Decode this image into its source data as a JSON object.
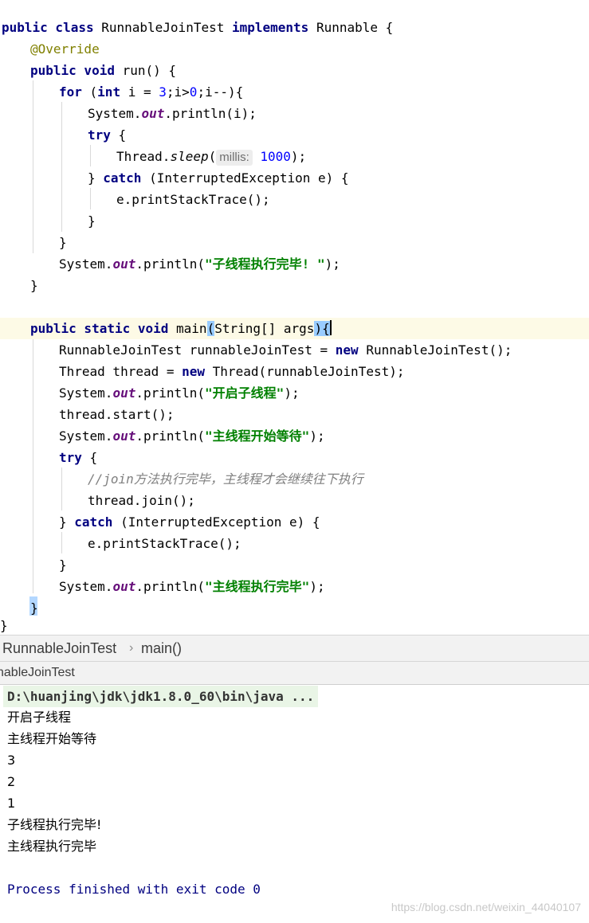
{
  "editor": {
    "code": {
      "class_decl": {
        "kw1": "public class",
        "name": " RunnableJoinTest ",
        "kw2": "implements",
        "rest": " Runnable {"
      },
      "annotation": "@Override",
      "run_decl": {
        "kw": "public void",
        "rest": " run() {"
      },
      "for_line": {
        "kw1": "for",
        "p1": " (",
        "kw2": "int",
        "p2": " i = ",
        "n1": "3",
        "p3": ";i>",
        "n2": "0",
        "p4": ";i--){"
      },
      "println_i": {
        "p1": "System.",
        "field": "out",
        "p2": ".println(i);"
      },
      "try1": {
        "kw": "try",
        "rest": " {"
      },
      "sleep": {
        "p1": "Thread.",
        "method": "sleep",
        "p2": "(",
        "hint": "millis:",
        "num": " 1000",
        "p3": ");"
      },
      "catch1": {
        "p1": "} ",
        "kw": "catch",
        "p2": " (InterruptedException e) {"
      },
      "stacktrace1": "e.printStackTrace();",
      "close_brace": "}",
      "println_done": {
        "p1": "System.",
        "field": "out",
        "p2": ".println(",
        "str": "\"子线程执行完毕! \"",
        "p3": ");"
      },
      "main_decl": {
        "kw": "public static void",
        "p1": " main",
        "open": "(",
        "p2": "String[] args",
        "close": ")",
        "brace": "{"
      },
      "new_runnable": {
        "p1": "RunnableJoinTest runnableJoinTest = ",
        "kw": "new",
        "p2": " RunnableJoinTest();"
      },
      "new_thread": {
        "p1": "Thread thread = ",
        "kw": "new",
        "p2": " Thread(runnableJoinTest);"
      },
      "println_start": {
        "p1": "System.",
        "field": "out",
        "p2": ".println(",
        "str": "\"开启子线程\"",
        "p3": ");"
      },
      "thread_start": "thread.start();",
      "println_wait": {
        "p1": "System.",
        "field": "out",
        "p2": ".println(",
        "str": "\"主线程开始等待\"",
        "p3": ");"
      },
      "try2": {
        "kw": "try",
        "rest": " {"
      },
      "comment": "//join方法执行完毕，主线程才会继续往下执行",
      "join": "thread.join();",
      "catch2": {
        "p1": "} ",
        "kw": "catch",
        "p2": " (InterruptedException e) {"
      },
      "stacktrace2": "e.printStackTrace();",
      "println_main_done": {
        "p1": "System.",
        "field": "out",
        "p2": ".println(",
        "str": "\"主线程执行完毕\"",
        "p3": ");"
      }
    }
  },
  "breadcrumb": {
    "class_name": "RunnableJoinTest",
    "separator": "›",
    "method": "main()"
  },
  "run_panel": {
    "tab_label": "nableJoinTest"
  },
  "console": {
    "command": "D:\\huanjing\\jdk\\jdk1.8.0_60\\bin\\java ...",
    "output": [
      "开启子线程",
      "主线程开始等待",
      "3",
      "2",
      "1",
      "子线程执行完毕!",
      "主线程执行完毕"
    ],
    "exit_message": "Process finished with exit code 0"
  },
  "watermark": "https://blog.csdn.net/weixin_44040107"
}
